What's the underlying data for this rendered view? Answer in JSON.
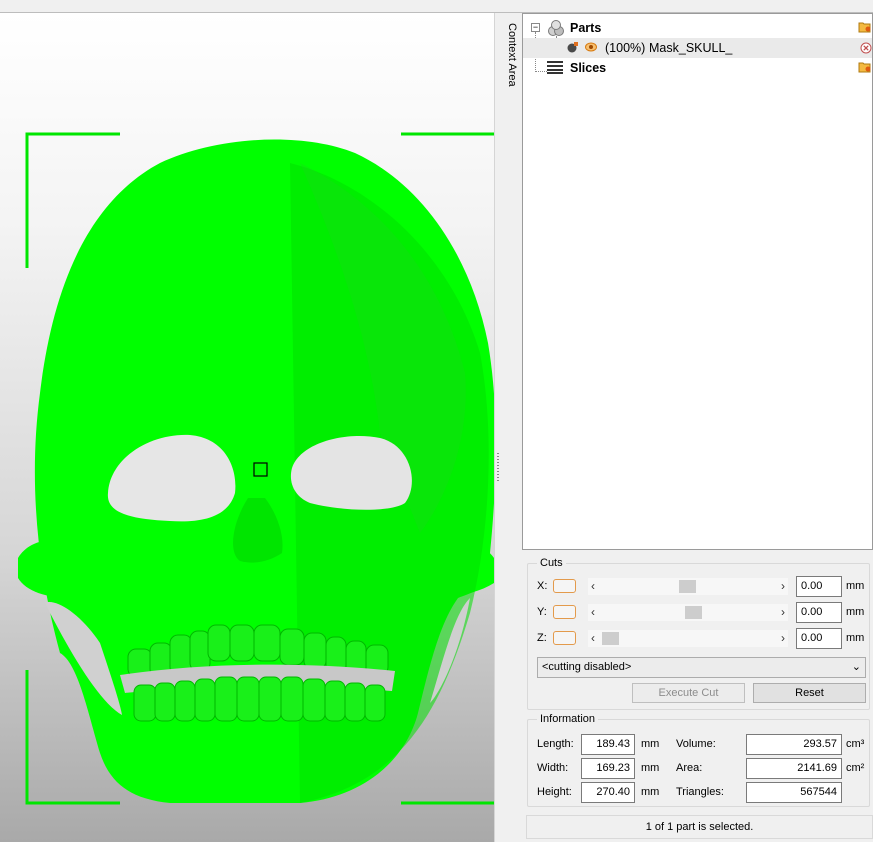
{
  "context_tab": {
    "label": "Context Area"
  },
  "tree": {
    "parts": {
      "label": "Parts"
    },
    "part_item": {
      "percent": "(100%)",
      "name": "Mask_SKULL_"
    },
    "slices": {
      "label": "Slices"
    }
  },
  "cuts": {
    "title": "Cuts",
    "x": {
      "label": "X:",
      "value": "0.00",
      "unit": "mm",
      "slider_pos": 0.5
    },
    "y": {
      "label": "Y:",
      "value": "0.00",
      "unit": "mm",
      "slider_pos": 0.55
    },
    "z": {
      "label": "Z:",
      "value": "0.00",
      "unit": "mm",
      "slider_pos": 0.0
    },
    "mode": "<cutting disabled>",
    "execute_label": "Execute Cut",
    "reset_label": "Reset"
  },
  "info": {
    "title": "Information",
    "length": {
      "label": "Length:",
      "value": "189.43",
      "unit": "mm"
    },
    "width": {
      "label": "Width:",
      "value": "169.23",
      "unit": "mm"
    },
    "height": {
      "label": "Height:",
      "value": "270.40",
      "unit": "mm"
    },
    "volume": {
      "label": "Volume:",
      "value": "293.57",
      "unit": "cm³"
    },
    "area": {
      "label": "Area:",
      "value": "2141.69",
      "unit": "cm²"
    },
    "triangles": {
      "label": "Triangles:",
      "value": "567544"
    }
  },
  "status": "1 of 1 part is selected.",
  "colors": {
    "model": "#00ff00",
    "selection": "#00e600",
    "accent_orange": "#e39a4b"
  },
  "icons": [
    "parts-icon",
    "open-folder-icon",
    "part-object-icon",
    "eye-icon",
    "remove-icon",
    "slices-icon",
    "chevron-left-icon",
    "chevron-right-icon",
    "chevron-down-icon"
  ]
}
